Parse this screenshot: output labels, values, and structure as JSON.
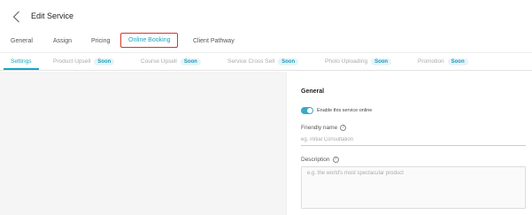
{
  "header": {
    "title": "Edit Service",
    "back_icon": "chevron-left-icon"
  },
  "tabs": [
    {
      "label": "General",
      "active": false
    },
    {
      "label": "Assign",
      "active": false
    },
    {
      "label": "Pricing",
      "active": false
    },
    {
      "label": "Online Booking",
      "active": true
    },
    {
      "label": "Client Pathway",
      "active": false
    }
  ],
  "subtabs": [
    {
      "label": "Settings",
      "badge": "",
      "active": true
    },
    {
      "label": "Product Upsell",
      "badge": "Soon",
      "active": false
    },
    {
      "label": "Course Upsell",
      "badge": "Soon",
      "active": false
    },
    {
      "label": "Service Cross Sell",
      "badge": "Soon",
      "active": false
    },
    {
      "label": "Photo Uploading",
      "badge": "Soon",
      "active": false
    },
    {
      "label": "Promotion",
      "badge": "Soon",
      "active": false
    }
  ],
  "panel": {
    "heading": "General",
    "toggle_label": "Enable this service online",
    "toggle_on": true,
    "friendly_name": {
      "label": "Friendly name",
      "placeholder": "eg. Initial Consultation",
      "value": ""
    },
    "description": {
      "label": "Description",
      "placeholder": "e.g. the world's most spectacular product",
      "value": ""
    }
  },
  "colors": {
    "accent": "#1aa3c4",
    "highlight_border": "#d9342b",
    "badge_bg": "#e7f4f8",
    "left_bg": "#f5f5f5"
  }
}
